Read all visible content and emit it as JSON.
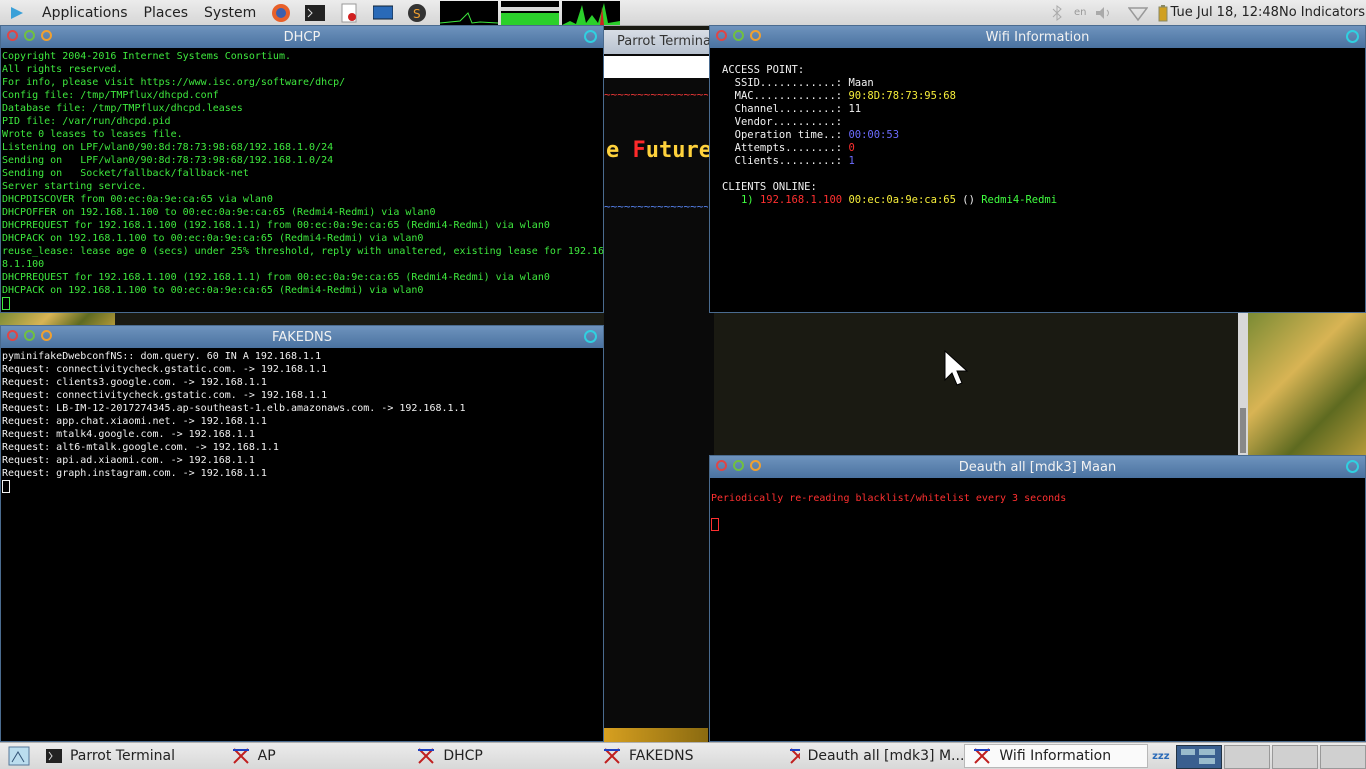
{
  "top_panel": {
    "menus": [
      "Applications",
      "Places",
      "System"
    ],
    "launcher_icons": [
      "firefox-icon",
      "terminal-icon",
      "text-editor-icon",
      "monitor-icon",
      "s-app-icon"
    ],
    "graphs": [
      "cpu-graph",
      "memory-graph",
      "network-graph"
    ],
    "tray": {
      "bluetooth_icon": "bluetooth-icon",
      "keyboard_layout": "en",
      "volume_icon": "volume-icon",
      "wifi_icon": "wifi-icon",
      "battery_icon": "battery-icon",
      "datetime": "Tue Jul 18, 12:48",
      "indicators": "No Indicators"
    }
  },
  "dhcp_window": {
    "title": "DHCP",
    "lines": [
      "Copyright 2004-2016 Internet Systems Consortium.",
      "All rights reserved.",
      "For info, please visit https://www.isc.org/software/dhcp/",
      "Config file: /tmp/TMPflux/dhcpd.conf",
      "Database file: /tmp/TMPflux/dhcpd.leases",
      "PID file: /var/run/dhcpd.pid",
      "Wrote 0 leases to leases file.",
      "Listening on LPF/wlan0/90:8d:78:73:98:68/192.168.1.0/24",
      "Sending on   LPF/wlan0/90:8d:78:73:98:68/192.168.1.0/24",
      "Sending on   Socket/fallback/fallback-net",
      "Server starting service.",
      "DHCPDISCOVER from 00:ec:0a:9e:ca:65 via wlan0",
      "DHCPOFFER on 192.168.1.100 to 00:ec:0a:9e:ca:65 (Redmi4-Redmi) via wlan0",
      "DHCPREQUEST for 192.168.1.100 (192.168.1.1) from 00:ec:0a:9e:ca:65 (Redmi4-Redmi) via wlan0",
      "DHCPACK on 192.168.1.100 to 00:ec:0a:9e:ca:65 (Redmi4-Redmi) via wlan0",
      "reuse_lease: lease age 0 (secs) under 25% threshold, reply with unaltered, existing lease for 192.16",
      "8.1.100",
      "DHCPREQUEST for 192.168.1.100 (192.168.1.1) from 00:ec:0a:9e:ca:65 (Redmi4-Redmi) via wlan0",
      "DHCPACK on 192.168.1.100 to 00:ec:0a:9e:ca:65 (Redmi4-Redmi) via wlan0"
    ]
  },
  "fakedns_window": {
    "title": "FAKEDNS",
    "lines": [
      "pyminifakeDwebconfNS:: dom.query. 60 IN A 192.168.1.1",
      "Request: connectivitycheck.gstatic.com. -> 192.168.1.1",
      "Request: clients3.google.com. -> 192.168.1.1",
      "Request: connectivitycheck.gstatic.com. -> 192.168.1.1",
      "Request: LB-IM-12-2017274345.ap-southeast-1.elb.amazonaws.com. -> 192.168.1.1",
      "Request: app.chat.xiaomi.net. -> 192.168.1.1",
      "Request: mtalk4.google.com. -> 192.168.1.1",
      "Request: alt6-mtalk.google.com. -> 192.168.1.1",
      "Request: api.ad.xiaomi.com. -> 192.168.1.1",
      "Request: graph.instagram.com. -> 192.168.1.1"
    ]
  },
  "parrot_bg": {
    "title": "Parrot Terminal",
    "red_squiggle": "~~~~~~~~~~~~~~~~~~~~~",
    "future_prefix": "e ",
    "future_red": "F",
    "future_rest": "uture",
    "blue_squiggle": "~~~~~~~~~~~~~~~~~~~~~"
  },
  "wifi_window": {
    "title": "Wifi Information",
    "access_point_header": "ACCESS POINT:",
    "ssid_label": "  SSID............: ",
    "ssid": "Maan",
    "mac_label": "  MAC.............: ",
    "mac": "90:8D:78:73:95:68",
    "channel_label": "  Channel.........: ",
    "channel": "11",
    "vendor_label": "  Vendor..........: ",
    "optime_label": "  Operation time..: ",
    "optime": "00:00:53",
    "attempts_label": "  Attempts........: ",
    "attempts": "0",
    "clients_label": "  Clients.........: ",
    "clients": "1",
    "clients_online_header": "CLIENTS ONLINE:",
    "client_index": "   1) ",
    "client_ip": "192.168.1.100",
    "client_mac": "00:ec:0a:9e:ca:65",
    "client_paren": " () ",
    "client_name": "Redmi4-Redmi"
  },
  "deauth_window": {
    "title": "Deauth all [mdk3]  Maan",
    "message": "Periodically re-reading blacklist/whitelist every 3 seconds"
  },
  "taskbar": {
    "items": [
      {
        "label": "Parrot Terminal",
        "icon": "terminal-icon"
      },
      {
        "label": "AP",
        "icon": "xterm-icon"
      },
      {
        "label": "DHCP",
        "icon": "xterm-icon"
      },
      {
        "label": "FAKEDNS",
        "icon": "xterm-icon"
      },
      {
        "label": "Deauth all [mdk3]  M...",
        "icon": "xterm-icon"
      },
      {
        "label": "Wifi Information",
        "icon": "xterm-icon"
      }
    ],
    "sleep_icon": "zzz"
  },
  "colors": {
    "terminal_green": "#3ee83e",
    "title_blue": "#4a72a0",
    "warning_red": "#ff3030",
    "value_yellow": "#f6ee3a"
  }
}
